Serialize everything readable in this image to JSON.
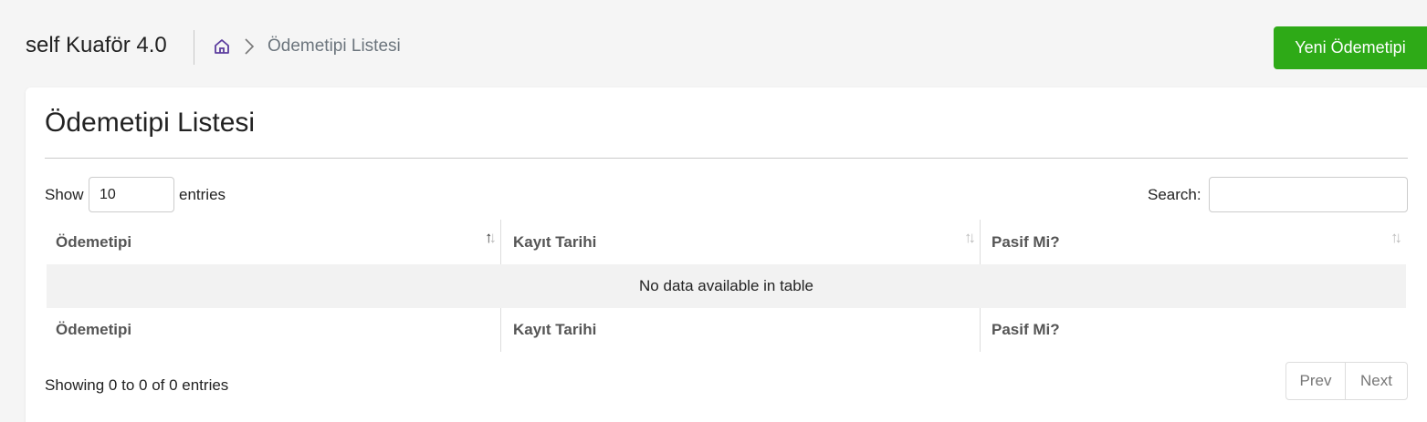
{
  "header": {
    "app_title": "self Kuaför 4.0",
    "breadcrumb": {
      "home_icon": "home-icon",
      "separator_icon": "chevron-right-icon",
      "current": "Ödemetipi Listesi"
    },
    "new_button_label": "Yeni Ödemetipi"
  },
  "card": {
    "title": "Ödemetipi Listesi",
    "length": {
      "show_label": "Show",
      "value": "10",
      "entries_label": "entries"
    },
    "search": {
      "label": "Search:",
      "value": ""
    },
    "table": {
      "columns": [
        "Ödemetipi",
        "Kayıt Tarihi",
        "Pasif Mi?"
      ],
      "empty_message": "No data available in table",
      "footer_columns": [
        "Ödemetipi",
        "Kayıt Tarihi",
        "Pasif Mi?"
      ]
    },
    "info": "Showing 0 to 0 of 0 entries",
    "pagination": {
      "prev": "Prev",
      "next": "Next"
    }
  },
  "colors": {
    "accent_green": "#2eaa17",
    "home_icon": "#5b3c9e"
  }
}
